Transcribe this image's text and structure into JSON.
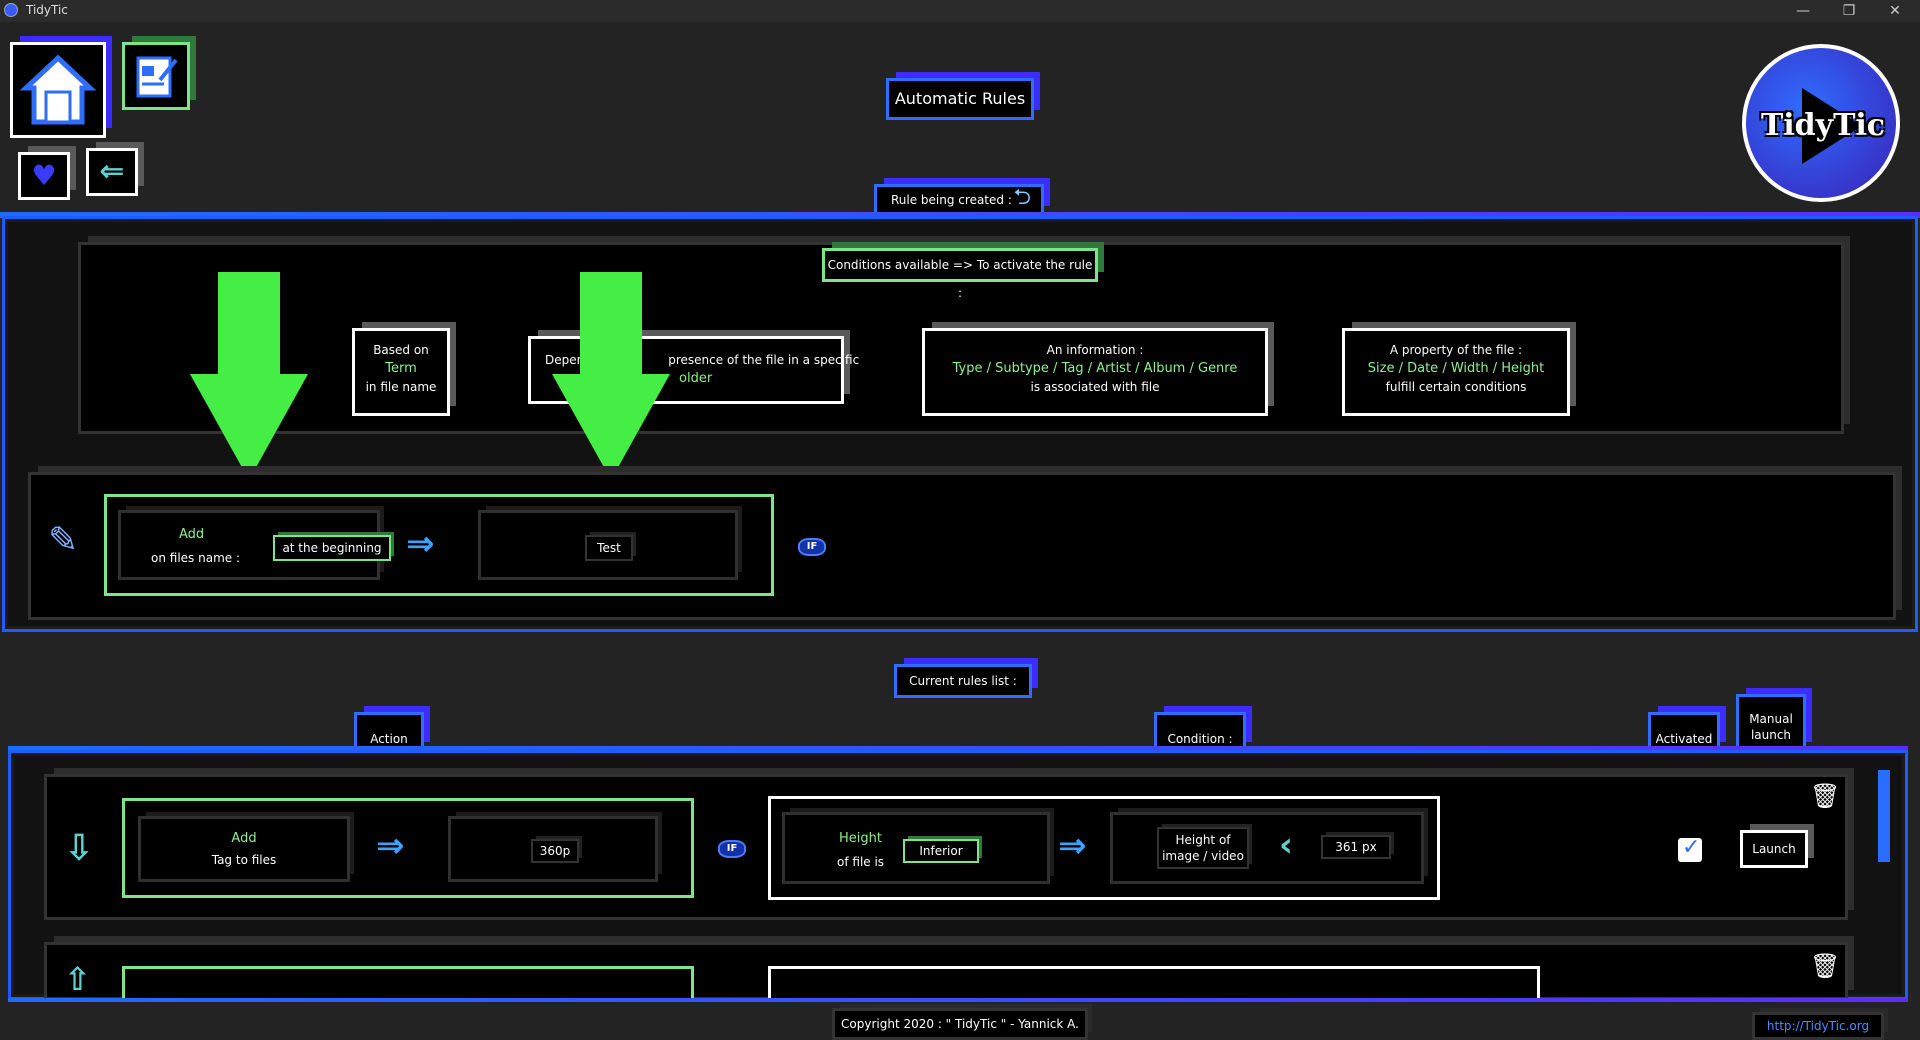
{
  "window": {
    "title": "TidyTic",
    "controls": [
      "—",
      "❐",
      "✕"
    ]
  },
  "header": {
    "page_title": "Automatic Rules",
    "rule_being_created": "Rule being created :",
    "logo_text": "TidyTic"
  },
  "conditions": {
    "title": "Conditions available => To activate the rule :",
    "cards": [
      {
        "l1": "Based on",
        "l2": "Term",
        "l3": "in file name"
      },
      {
        "l1": "Depen",
        "l1b": "presence of the file in a specific",
        "l2": "older"
      },
      {
        "l1": "An information :",
        "l2": "Type / Subtype / Tag / Artist / Album / Genre",
        "l3": "is associated with file"
      },
      {
        "l1": "A property of the file :",
        "l2": "Size / Date / Width / Height",
        "l3": "fulfill certain conditions"
      }
    ]
  },
  "editor": {
    "action_title": "Add",
    "action_sub": "on files name :",
    "position": "at the beginning",
    "value": "Test",
    "if": "IF"
  },
  "rules": {
    "title": "Current rules list :",
    "col_action": "Action",
    "col_condition": "Condition :",
    "col_activated": "Activated",
    "col_manual_l1": "Manual",
    "col_manual_l2": "launch",
    "row1": {
      "action_title": "Add",
      "action_sub": "Tag to files",
      "value": "360p",
      "if": "IF",
      "cond_title": "Height",
      "cond_sub": "of file is",
      "comparator": "Inferior",
      "target_l1": "Height of",
      "target_l2": "image / video",
      "target_value": "361 px",
      "launch": "Launch"
    }
  },
  "footer": {
    "copyright": "Copyright 2020 : \" TidyTic \" - Yannick A.",
    "url": "http://TidyTic.org"
  },
  "colors": {
    "accent_blue": "#1f5cff",
    "accent_green": "#7fe38a",
    "highlight_arrow": "#44ee44"
  }
}
